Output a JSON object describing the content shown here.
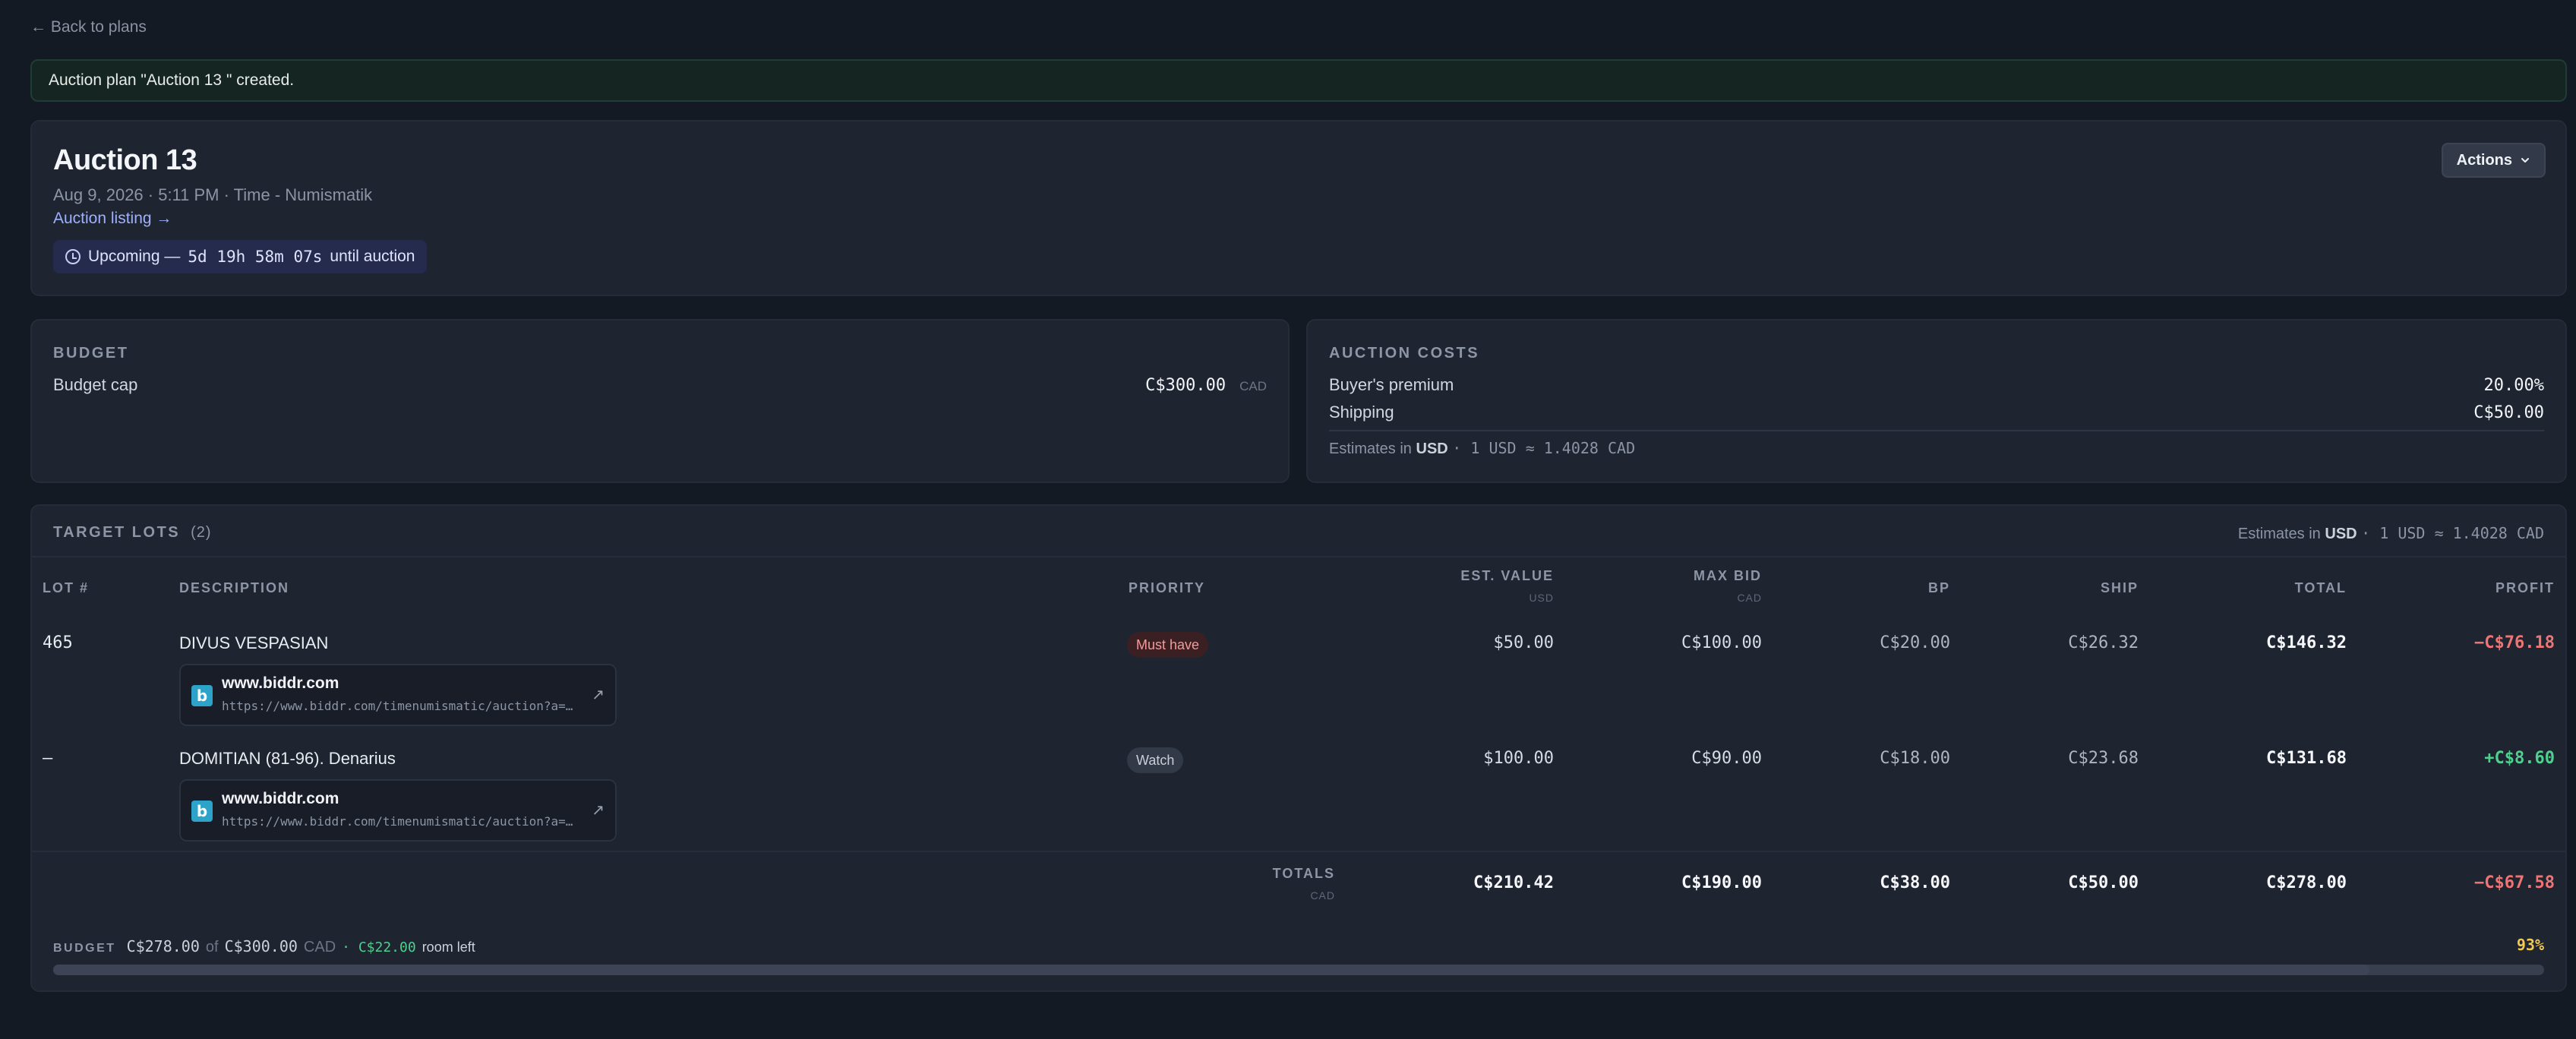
{
  "nav": {
    "back": "← Back to plans"
  },
  "flash": "Auction plan \"Auction 13 \" created.",
  "plan": {
    "title": "Auction 13",
    "meta": "Aug 9, 2026 · 5:11 PM · Time - Numismatik",
    "listing_link": "Auction listing →",
    "countdown_prefix": "Upcoming —",
    "countdown_value": "5d 19h 58m 07s",
    "countdown_suffix": "until auction",
    "actions_label": "Actions"
  },
  "budget": {
    "section": "BUDGET",
    "cap_label": "Budget cap",
    "cap_value": "C$300.00",
    "cap_currency": "CAD"
  },
  "costs": {
    "section": "AUCTION COSTS",
    "bp_label": "Buyer's premium",
    "bp_value": "20.00%",
    "ship_label": "Shipping",
    "ship_value": "C$50.00",
    "estimate_prefix": "Estimates in",
    "estimate_currency": "USD",
    "estimate_rate": "· 1 USD ≈ 1.4028 CAD"
  },
  "lots": {
    "section": "TARGET LOTS",
    "count": "(2)",
    "estimate_prefix": "Estimates in",
    "estimate_currency": "USD",
    "estimate_rate": "· 1 USD ≈ 1.4028 CAD",
    "columns": {
      "lot": "LOT #",
      "description": "DESCRIPTION",
      "priority": "PRIORITY",
      "est_value": "EST. VALUE",
      "est_value_sub": "USD",
      "max_bid": "MAX BID",
      "max_bid_sub": "CAD",
      "bp": "BP",
      "ship": "SHIP",
      "total": "TOTAL",
      "profit": "PROFIT"
    },
    "rows": [
      {
        "lot": "465",
        "description": "DIVUS VESPASIAN",
        "link_domain": "www.biddr.com",
        "link_url": "https://www.biddr.com/timenumismatic/auction?a=…",
        "priority": "Must have",
        "est_value": "$50.00",
        "max_bid": "C$100.00",
        "bp": "C$20.00",
        "ship": "C$26.32",
        "total": "C$146.32",
        "profit": "−C$76.18"
      },
      {
        "lot": "—",
        "description": "DOMITIAN (81-96). Denarius",
        "link_domain": "www.biddr.com",
        "link_url": "https://www.biddr.com/timenumismatic/auction?a=…",
        "priority": "Watch",
        "est_value": "$100.00",
        "max_bid": "C$90.00",
        "bp": "C$18.00",
        "ship": "C$23.68",
        "total": "C$131.68",
        "profit": "+C$8.60"
      }
    ],
    "totals": {
      "label": "TOTALS",
      "sub": "CAD",
      "est_value": "C$210.42",
      "max_bid": "C$190.00",
      "bp": "C$38.00",
      "ship": "C$50.00",
      "total": "C$278.00",
      "profit": "−C$67.58"
    },
    "budget_bar": {
      "label": "BUDGET",
      "used": "C$278.00",
      "of": "of",
      "cap": "C$300.00",
      "currency": "CAD",
      "room_value": "· C$22.00",
      "room_text": "room left",
      "percent": "93%",
      "fraction": 0.93
    }
  },
  "colors": {
    "negative": "#f07474",
    "positive": "#4fd08e",
    "warning": "#f2c94c",
    "link": "#9fb0ff",
    "favicon": "#2ea3c9"
  }
}
